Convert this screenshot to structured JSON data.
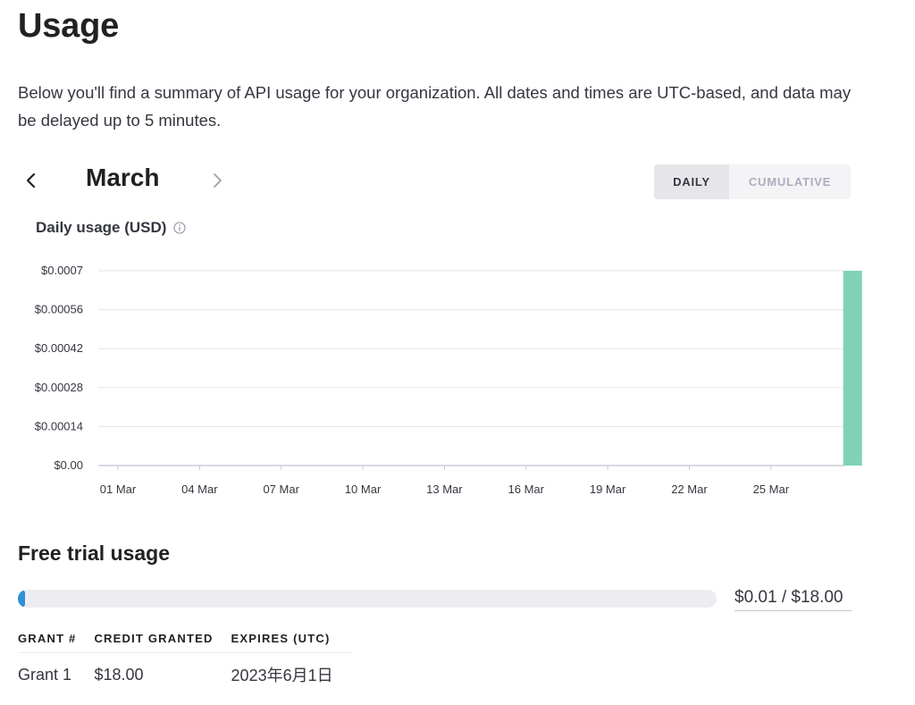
{
  "page": {
    "title": "Usage",
    "description": "Below you'll find a summary of API usage for your organization. All dates and times are UTC-based, and data may be delayed up to 5 minutes."
  },
  "month_nav": {
    "month": "March",
    "prev_icon": "chevron-left-icon",
    "next_icon": "chevron-right-icon"
  },
  "view_toggle": {
    "daily_label": "DAILY",
    "cumulative_label": "CUMULATIVE",
    "selected": "DAILY"
  },
  "chart_header": {
    "title": "Daily usage (USD)",
    "info_icon": "info-icon"
  },
  "chart_data": {
    "type": "bar",
    "title": "Daily usage (USD)",
    "xlabel": "",
    "ylabel": "",
    "ylim": [
      0,
      0.0007
    ],
    "yticks": [
      "$0.00",
      "$0.00014",
      "$0.00028",
      "$0.00042",
      "$0.00056",
      "$0.0007"
    ],
    "xticks": [
      "01 Mar",
      "04 Mar",
      "07 Mar",
      "10 Mar",
      "13 Mar",
      "16 Mar",
      "19 Mar",
      "22 Mar",
      "25 Mar"
    ],
    "categories": [
      "01 Mar",
      "02 Mar",
      "03 Mar",
      "04 Mar",
      "05 Mar",
      "06 Mar",
      "07 Mar",
      "08 Mar",
      "09 Mar",
      "10 Mar",
      "11 Mar",
      "12 Mar",
      "13 Mar",
      "14 Mar",
      "15 Mar",
      "16 Mar",
      "17 Mar",
      "18 Mar",
      "19 Mar",
      "20 Mar",
      "21 Mar",
      "22 Mar",
      "23 Mar",
      "24 Mar",
      "25 Mar",
      "26 Mar",
      "27 Mar",
      "28 Mar"
    ],
    "values": [
      0,
      0,
      0,
      0,
      0,
      0,
      0,
      0,
      0,
      0,
      0,
      0,
      0,
      0,
      0,
      0,
      0,
      0,
      0,
      0,
      0,
      0,
      0,
      0,
      0,
      0,
      0,
      0.0007
    ],
    "bar_color": "#7fd3b4",
    "grid": true
  },
  "free_trial": {
    "title": "Free trial usage",
    "used_fraction": 0.00056,
    "label": "$0.01 / $18.00",
    "bar_color": "#2e8fd6"
  },
  "grants": {
    "headers": [
      "GRANT #",
      "CREDIT GRANTED",
      "EXPIRES (UTC)"
    ],
    "rows": [
      [
        "Grant 1",
        "$18.00",
        "2023年6月1日"
      ]
    ]
  }
}
